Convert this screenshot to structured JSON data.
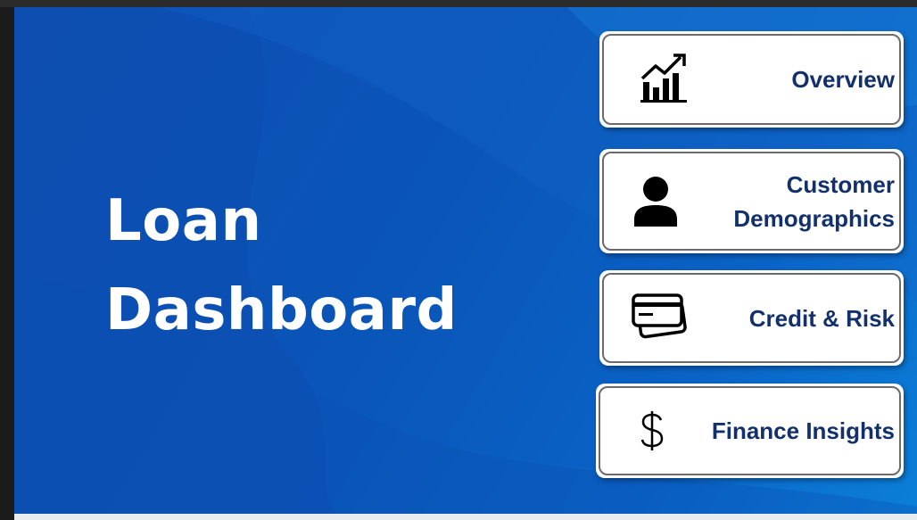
{
  "title": {
    "line1": "Loan",
    "line2": "Dashboard"
  },
  "nav": [
    {
      "label_lines": [
        "Overview"
      ],
      "icon": "bar-chart-trend-icon"
    },
    {
      "label_lines": [
        "Customer",
        "Demographics"
      ],
      "icon": "person-icon"
    },
    {
      "label_lines": [
        "Credit & Risk"
      ],
      "icon": "credit-card-icon"
    },
    {
      "label_lines": [
        "Finance Insights"
      ],
      "icon": "dollar-sign-icon"
    }
  ],
  "colors": {
    "background_blue": "#0a55b8",
    "label_navy": "#12306b",
    "card_border": "#6b6b6b"
  }
}
